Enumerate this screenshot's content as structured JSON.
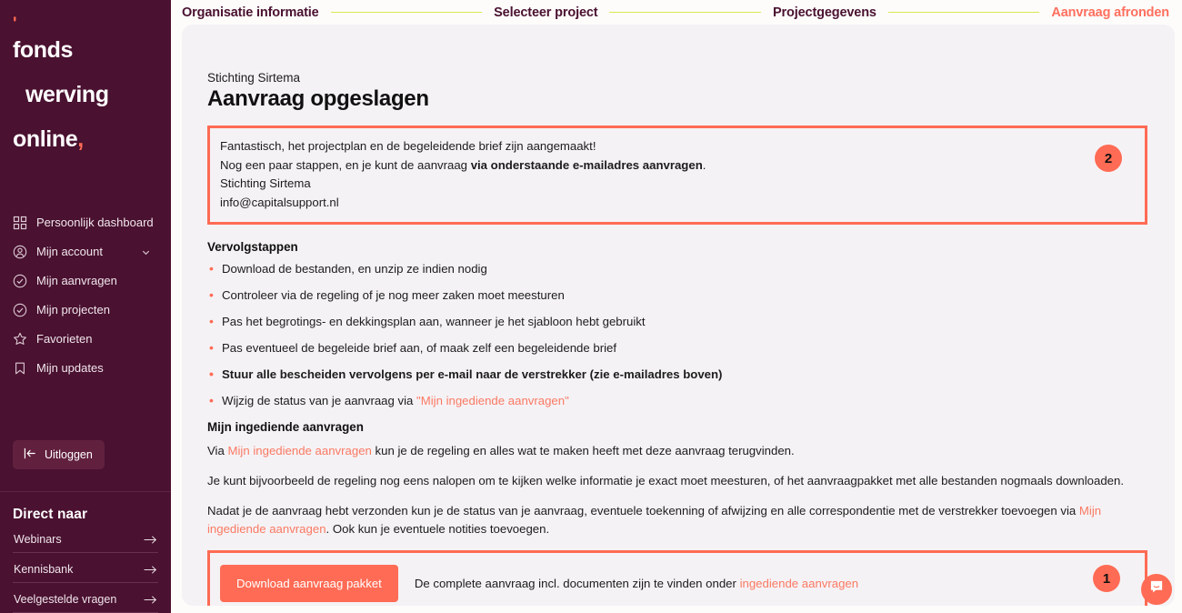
{
  "brand": {
    "line1": "fonds",
    "line2": "werving",
    "line3": "online",
    "comma": ",",
    "quote": "'",
    "accent_color": "#ff6b54",
    "sidebar_bg": "#4a1130"
  },
  "sidebar": {
    "items": [
      {
        "label": "Persoonlijk dashboard",
        "icon": "grid-icon",
        "has_chevron": false
      },
      {
        "label": "Mijn account",
        "icon": "user-circle-icon",
        "has_chevron": true
      },
      {
        "label": "Mijn aanvragen",
        "icon": "check-circle-icon",
        "has_chevron": false
      },
      {
        "label": "Mijn projecten",
        "icon": "check-circle-icon",
        "has_chevron": false
      },
      {
        "label": "Favorieten",
        "icon": "star-icon",
        "has_chevron": false
      },
      {
        "label": "Mijn updates",
        "icon": "bookmark-icon",
        "has_chevron": false
      }
    ],
    "logout_label": "Uitloggen",
    "direct_title": "Direct naar",
    "direct_links": [
      {
        "label": "Webinars"
      },
      {
        "label": "Kennisbank"
      },
      {
        "label": "Veelgestelde vragen"
      }
    ]
  },
  "steps": [
    {
      "label": "Organisatie informatie",
      "active": false
    },
    {
      "label": "Selecteer project",
      "active": false
    },
    {
      "label": "Projectgegevens",
      "active": false
    },
    {
      "label": "Aanvraag afronden",
      "active": true
    }
  ],
  "header": {
    "org_name": "Stichting Sirtema",
    "title": "Aanvraag opgeslagen"
  },
  "highlight_box": {
    "badge": "2",
    "line1": "Fantastisch, het projectplan en de begeleidende brief zijn aangemaakt!",
    "line2_prefix": "Nog een paar stappen, en je kunt de aanvraag ",
    "line2_bold": "via onderstaande e-mailadres aanvragen",
    "line2_suffix": ".",
    "line3": "Stichting Sirtema",
    "line4": "info@capitalsupport.nl"
  },
  "next_steps": {
    "title": "Vervolgstappen",
    "items": [
      {
        "text": "Download de bestanden, en unzip ze indien nodig",
        "bold": false
      },
      {
        "text": "Controleer via de regeling of je nog meer zaken moet meesturen",
        "bold": false
      },
      {
        "text": "Pas het begrotings- en dekkingsplan aan, wanneer je het sjabloon hebt gebruikt",
        "bold": false
      },
      {
        "text": "Pas eventueel de begeleide brief aan, of maak zelf een begeleidende brief",
        "bold": false
      },
      {
        "text": "Stuur alle bescheiden vervolgens per e-mail naar de verstrekker (zie e-mailadres boven)",
        "bold": true
      }
    ],
    "last_item_prefix": "Wijzig de status van je aanvraag via ",
    "last_item_link": "\"Mijn ingediende aanvragen\""
  },
  "submitted": {
    "title": "Mijn ingediende aanvragen",
    "p1_prefix": "Via ",
    "p1_link": "Mijn ingediende aanvragen",
    "p1_suffix": " kun je de regeling en alles wat te maken heeft met deze aanvraag terugvinden.",
    "p2": "Je kunt bijvoorbeeld de regeling nog eens nalopen om te kijken welke informatie je exact moet meesturen, of het aanvraagpakket met alle bestanden nogmaals downloaden.",
    "p3_prefix": "Nadat je de aanvraag hebt verzonden kun je de status van je aanvraag, eventuele toekenning of afwijzing en alle correspondentie met de verstrekker toevoegen via ",
    "p3_link": "Mijn ingediende aanvragen",
    "p3_suffix": ". Ook kun je eventuele notities toevoegen."
  },
  "download_box": {
    "badge": "1",
    "button_label": "Download aanvraag pakket",
    "text_prefix": "De complete aanvraag incl. documenten zijn te vinden onder ",
    "text_link": "ingediende aanvragen"
  },
  "chat": {
    "icon": "chat-bubble-icon"
  }
}
